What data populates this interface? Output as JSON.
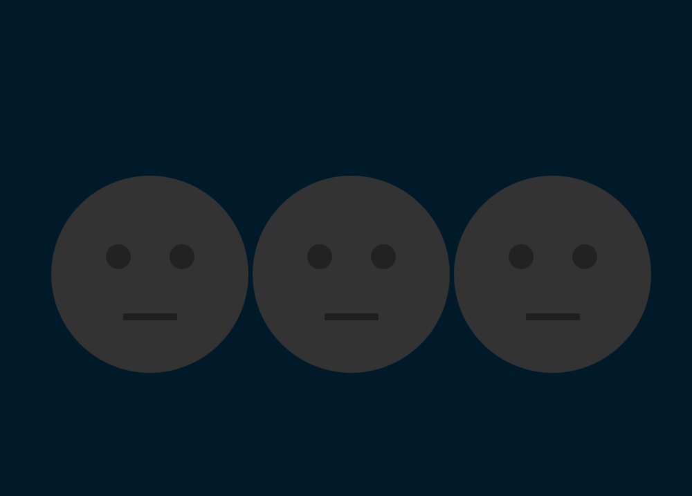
{
  "background_color": "#001a2a",
  "faces": [
    {
      "icon": "neutral-face-icon",
      "expression": "neutral",
      "color": "#333333"
    },
    {
      "icon": "neutral-face-icon",
      "expression": "neutral",
      "color": "#333333"
    },
    {
      "icon": "neutral-face-icon",
      "expression": "neutral",
      "color": "#333333"
    }
  ],
  "feature_color": "#222222"
}
